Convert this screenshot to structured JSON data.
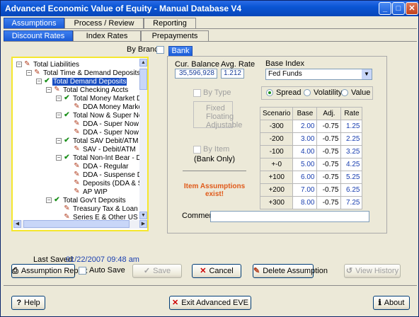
{
  "window": {
    "title": "Advanced Economic Value of Equity - Manual Database V4",
    "min": "_",
    "max": "□",
    "close": "✕"
  },
  "tabs_top": [
    {
      "label": "Assumptions",
      "active": true
    },
    {
      "label": "Process / Review",
      "active": false
    },
    {
      "label": "Reporting",
      "active": false
    }
  ],
  "tabs_second": [
    {
      "label": "Discount Rates",
      "active": true
    },
    {
      "label": "Index Rates",
      "active": false
    },
    {
      "label": "Prepayments",
      "active": false
    }
  ],
  "by_branch_label": "By Branch",
  "bank_tab_label": "Bank",
  "tree": [
    {
      "level": 0,
      "label": "Total Liabilities",
      "icon": "pen",
      "pm": "-"
    },
    {
      "level": 1,
      "label": "Total Time & Demand Deposits",
      "icon": "pen",
      "pm": "-"
    },
    {
      "level": 2,
      "label": "Total Demand Deposits",
      "icon": "check",
      "pm": "-",
      "selected": true
    },
    {
      "level": 3,
      "label": "Total Checking Accts",
      "icon": "pen",
      "pm": "-"
    },
    {
      "level": 4,
      "label": "Total Money Market DDA",
      "icon": "check",
      "pm": "-"
    },
    {
      "level": 5,
      "label": "DDA Money Market",
      "icon": "pen",
      "pm": ""
    },
    {
      "level": 4,
      "label": "Total Now & Super Now",
      "icon": "check",
      "pm": "-"
    },
    {
      "level": 5,
      "label": "DDA - Super Now Pe",
      "icon": "pen",
      "pm": ""
    },
    {
      "level": 5,
      "label": "DDA - Super Now Bu",
      "icon": "pen",
      "pm": ""
    },
    {
      "level": 4,
      "label": "Total SAV Debit/ATM",
      "icon": "check",
      "pm": "-"
    },
    {
      "level": 5,
      "label": "SAV - Debit/ATM",
      "icon": "pen",
      "pm": ""
    },
    {
      "level": 4,
      "label": "Total Non-Int Bear - DDA",
      "icon": "check",
      "pm": "-"
    },
    {
      "level": 5,
      "label": "DDA - Regular",
      "icon": "pen",
      "pm": ""
    },
    {
      "level": 5,
      "label": "DDA - Suspense Dr",
      "icon": "pen",
      "pm": ""
    },
    {
      "level": 5,
      "label": "Deposits (DDA & SAV",
      "icon": "pen",
      "pm": ""
    },
    {
      "level": 5,
      "label": "AP WIP",
      "icon": "pen",
      "pm": ""
    },
    {
      "level": 3,
      "label": "Total Gov't Deposits",
      "icon": "check",
      "pm": "-"
    },
    {
      "level": 4,
      "label": "Treasury Tax & Loan",
      "icon": "pen",
      "pm": ""
    },
    {
      "level": 4,
      "label": "Series E & Other US Gov",
      "icon": "pen",
      "pm": ""
    }
  ],
  "detail": {
    "cur_balance_label": "Cur. Balance",
    "cur_balance": "35,596,928",
    "avg_rate_label": "Avg. Rate",
    "avg_rate": "1.212",
    "base_index_label": "Base Index",
    "base_index": "Fed Funds",
    "by_type_label": "By Type",
    "type_options": [
      "Fixed",
      "Floating",
      "Adjustable"
    ],
    "by_item_label": "By Item",
    "bank_only_label": "(Bank Only)",
    "item_assumptions_text": "Item Assumptions exist!",
    "comment_label": "Comment:",
    "comment": "",
    "mode_options": [
      {
        "label": "Spread",
        "selected": true
      },
      {
        "label": "Volatility",
        "selected": false
      },
      {
        "label": "Value",
        "selected": false
      }
    ]
  },
  "scenario_table": {
    "headers": [
      "Scenario",
      "Base",
      "Adj.",
      "Rate"
    ],
    "rows": [
      [
        "-300",
        "2.00",
        "-0.75",
        "1.25"
      ],
      [
        "-200",
        "3.00",
        "-0.75",
        "2.25"
      ],
      [
        "-100",
        "4.00",
        "-0.75",
        "3.25"
      ],
      [
        "+-0",
        "5.00",
        "-0.75",
        "4.25"
      ],
      [
        "+100",
        "6.00",
        "-0.75",
        "5.25"
      ],
      [
        "+200",
        "7.00",
        "-0.75",
        "6.25"
      ],
      [
        "+300",
        "8.00",
        "-0.75",
        "7.25"
      ]
    ]
  },
  "last_saved_label": "Last Saved:",
  "last_saved": "01/22/2007 09:48 am",
  "buttons": {
    "assumption_report": "Assumption Report",
    "auto_save": "Auto Save",
    "save": "Save",
    "cancel": "Cancel",
    "delete_assumption": "Delete Assumption",
    "view_history": "View History",
    "help": "Help",
    "exit": "Exit Advanced EVE",
    "about": "About"
  },
  "colors": {
    "accent": "#1a5bd6",
    "highlight": "#f5e72e",
    "warning": "#e05a1a",
    "value_blue": "#1a3fb0"
  }
}
